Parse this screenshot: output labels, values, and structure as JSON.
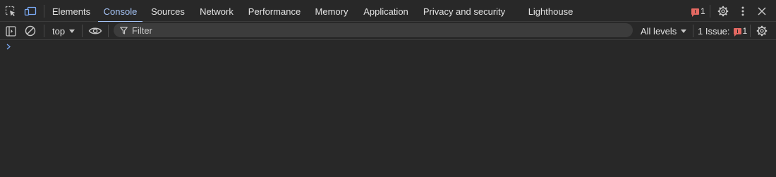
{
  "tabs": [
    {
      "label": "Elements",
      "active": false
    },
    {
      "label": "Console",
      "active": true
    },
    {
      "label": "Sources",
      "active": false
    },
    {
      "label": "Network",
      "active": false
    },
    {
      "label": "Performance",
      "active": false
    },
    {
      "label": "Memory",
      "active": false
    },
    {
      "label": "Application",
      "active": false
    },
    {
      "label": "Privacy and security",
      "active": false
    },
    {
      "label": "Lighthouse",
      "active": false
    }
  ],
  "header": {
    "issues_count": "1"
  },
  "toolbar": {
    "context": "top",
    "filter_placeholder": "Filter",
    "filter_value": "",
    "levels": "All levels",
    "issues_label": "1 Issue:",
    "issues_count": "1"
  },
  "icons": {
    "inspect": "inspect-element-icon",
    "device": "device-toolbar-icon",
    "settings": "gear-icon",
    "more": "more-vertical-icon",
    "close": "close-icon",
    "sidebar": "sidebar-toggle-icon",
    "clear": "clear-console-icon",
    "live_expression": "eye-icon",
    "filter": "filter-icon",
    "prompt": "chevron-right-icon"
  },
  "colors": {
    "background": "#282828",
    "accent": "#a8c7fa",
    "error": "#e46962",
    "text": "#e3e3e3"
  }
}
